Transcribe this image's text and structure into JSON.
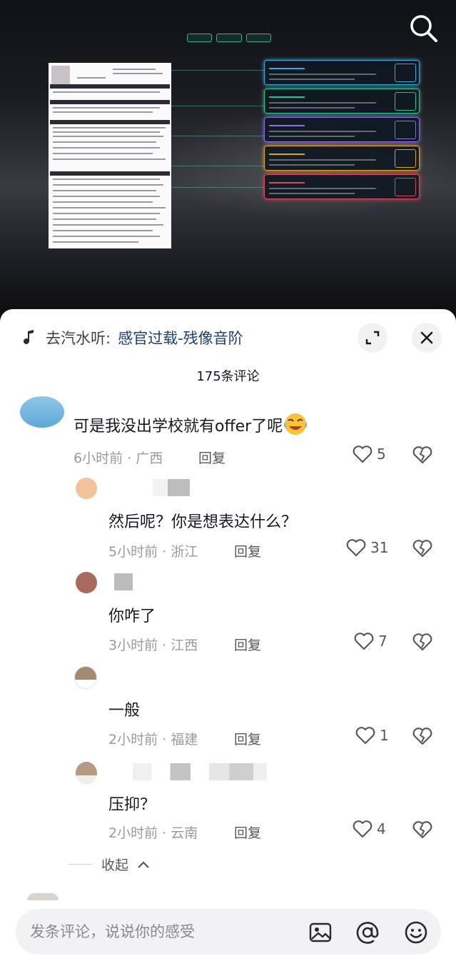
{
  "music": {
    "prefix": "去汽水听:",
    "song": "感官过载-残像音阶"
  },
  "comment_count": "175条评论",
  "comments": [
    {
      "text": "可是我没出学校就有offer了呢",
      "emoji": "crying-laughing-emoji",
      "time": "6小时前",
      "location": "广西",
      "reply": "回复",
      "likes": "5"
    },
    {
      "text": "然后呢？你是想表达什么？",
      "time": "5小时前",
      "location": "浙江",
      "reply": "回复",
      "likes": "31"
    },
    {
      "text": "你咋了",
      "time": "3小时前",
      "location": "江西",
      "reply": "回复",
      "likes": "7"
    },
    {
      "text": "一般",
      "time": "2小时前",
      "location": "福建",
      "reply": "回复",
      "likes": "1"
    },
    {
      "text": "压抑？",
      "time": "2小时前",
      "location": "云南",
      "reply": "回复",
      "likes": "4"
    }
  ],
  "meta_sep": " · ",
  "collapse_label": "收起",
  "input": {
    "placeholder": "发条评论，说说你的感受"
  },
  "colors": {
    "link": "#1f3f6f",
    "muted": "#9a9a9e",
    "panel_bg": "#ffffff"
  }
}
